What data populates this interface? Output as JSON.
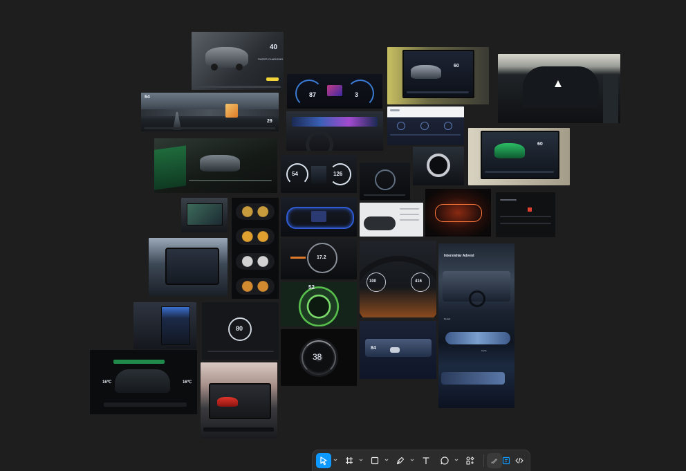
{
  "canvas": {
    "background": "#1e1e1e"
  },
  "frames": {
    "f01": {
      "speed": "40",
      "label": "SUPER CHARGING"
    },
    "f02": {
      "speed": "64",
      "range": "29"
    },
    "f03": {},
    "f04": {
      "left": "87",
      "right": "3"
    },
    "f05": {},
    "f06": {
      "speed": "60"
    },
    "f07": {},
    "f08": {},
    "f09": {
      "speed": "60"
    },
    "f10": {
      "left": "54",
      "right": "126"
    },
    "f11": {},
    "f12": {},
    "f13": {},
    "f14": {},
    "f15": {},
    "f16": {},
    "f17": {
      "speed": "17.2"
    },
    "f18": {
      "left": "100",
      "right": "416"
    },
    "f19": {
      "title": "Interstellar Advent",
      "mid_label": "Design",
      "bottom_label": "Cycle"
    },
    "f20": {
      "speed": "52"
    },
    "f21": {},
    "f22": {
      "speed": "80"
    },
    "f23": {
      "speed": "38"
    },
    "f24": {
      "speed": "84"
    },
    "f25": {
      "left_temp": "16℃",
      "right_temp": "16℃"
    },
    "f26": {}
  },
  "toolbar": {
    "tools": [
      {
        "name": "move-tool",
        "icon": "cursor-arrow-icon",
        "active": true
      },
      {
        "name": "frame-tool",
        "icon": "hash-frame-icon"
      },
      {
        "name": "shape-tool",
        "icon": "rectangle-icon"
      },
      {
        "name": "pen-tool",
        "icon": "pen-nib-icon"
      },
      {
        "name": "text-tool",
        "icon": "text-t-icon"
      },
      {
        "name": "comment-tool",
        "icon": "speech-bubble-icon"
      },
      {
        "name": "actions-tool",
        "icon": "components-icon"
      },
      {
        "name": "draw-mode-tool",
        "icon": "draw-pencil-icon"
      },
      {
        "name": "design-mode-tool",
        "icon": "design-mode-icon"
      },
      {
        "name": "dev-mode-tool",
        "icon": "code-brackets-icon"
      }
    ],
    "accent": "#0d99ff",
    "background": "#2c2c2c"
  }
}
